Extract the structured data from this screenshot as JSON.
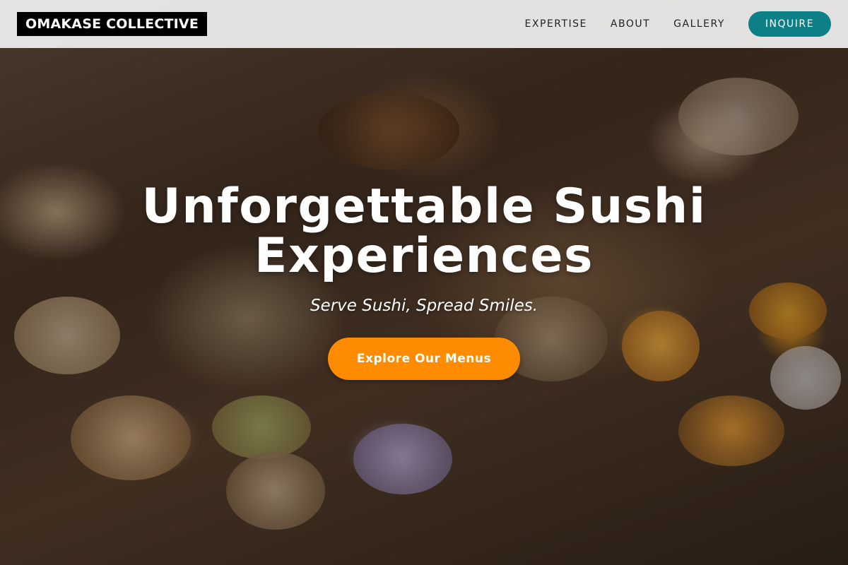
{
  "nav": {
    "brand": "OMAKASE COLLECTIVE",
    "links": [
      "EXPERTISE",
      "ABOUT",
      "GALLERY"
    ],
    "inquire": "INQUIRE"
  },
  "hero": {
    "title": "Unforgettable Sushi Experiences",
    "subtitle": "Serve Sushi, Spread Smiles.",
    "cta": "Explore Our Menus",
    "background_image": "catering platter of sushi bites, tartlets and skewered appetizers"
  },
  "colors": {
    "inquire_button": "#0d7f86",
    "cta_button": "#ff8c00",
    "brand_bg": "#000000",
    "navbar_bg": "#f0f0f0"
  }
}
